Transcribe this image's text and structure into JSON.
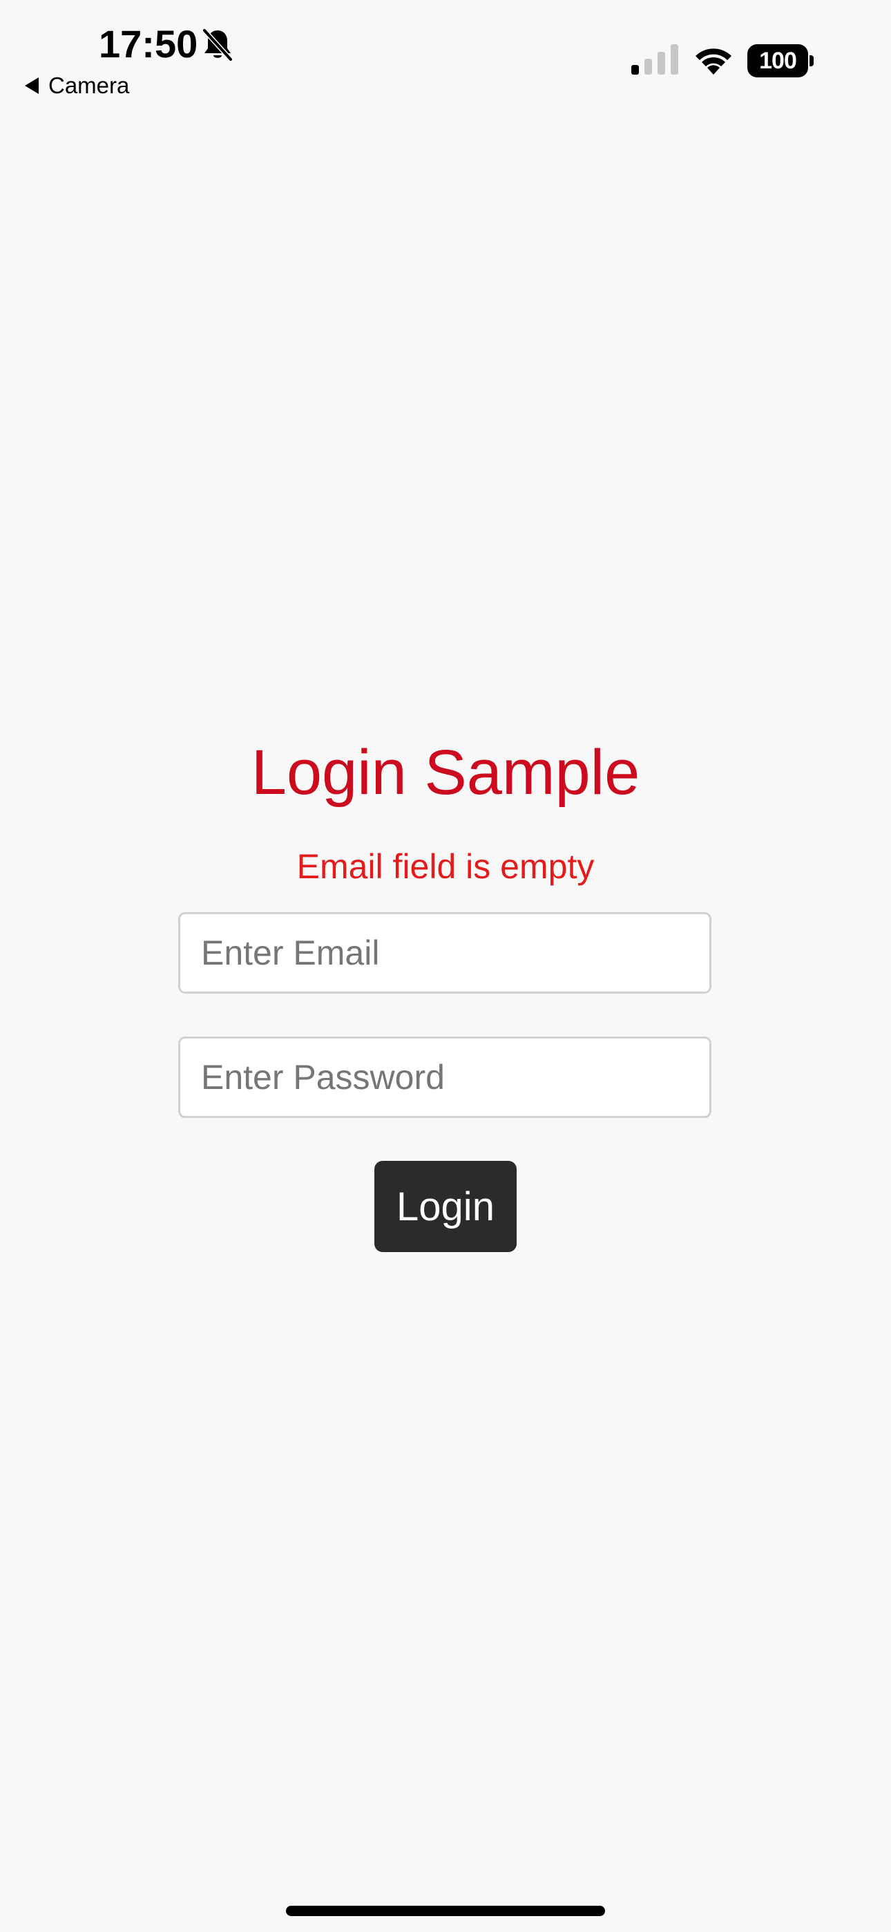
{
  "status_bar": {
    "time": "17:50",
    "silent_icon": "bell-slash-icon",
    "back_label": "Camera",
    "signal_icon": "cellular-signal-icon",
    "signal_bars_active": 1,
    "signal_bars_total": 4,
    "wifi_icon": "wifi-icon",
    "battery_level": "100"
  },
  "login": {
    "title": "Login Sample",
    "error_message": "Email field is empty",
    "email_placeholder": "Enter Email",
    "email_value": "",
    "password_placeholder": "Enter Password",
    "password_value": "",
    "button_label": "Login"
  },
  "colors": {
    "title": "#cc0b1e",
    "error": "#e31b1b",
    "button_bg": "#2b2b2b",
    "page_bg": "#f8f8f8"
  }
}
